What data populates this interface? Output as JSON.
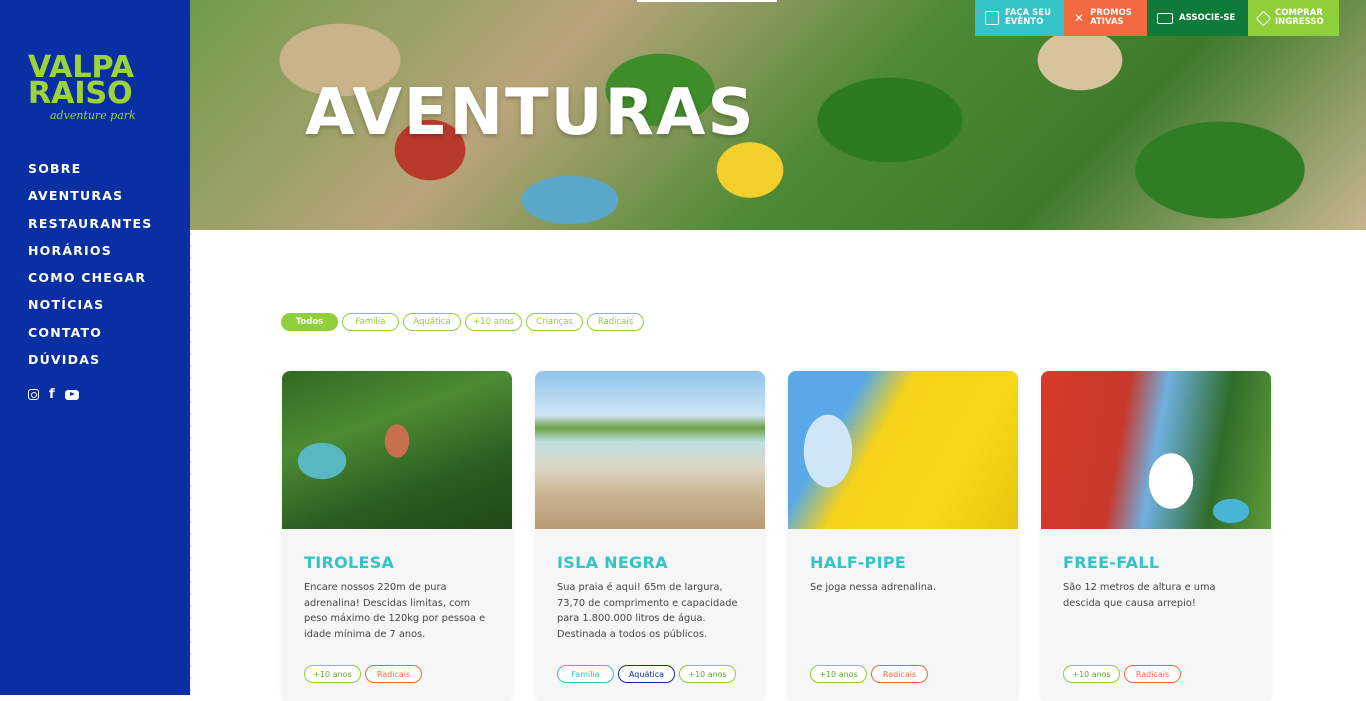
{
  "brand": {
    "logo_line1": "VALPA",
    "logo_line2": "RAISO",
    "logo_sub": "adventure park",
    "primary_color": "#0a2fa3",
    "accent_green": "#8fcf3a",
    "accent_teal": "#34c3c6"
  },
  "nav": {
    "items": [
      "SOBRE",
      "AVENTURAS",
      "RESTAURANTES",
      "HORÁRIOS",
      "COMO CHEGAR",
      "NOTÍCIAS",
      "CONTATO",
      "DÚVIDAS"
    ]
  },
  "social": [
    "instagram-icon",
    "facebook-icon",
    "youtube-icon"
  ],
  "hero": {
    "title": "AVENTURAS"
  },
  "top_actions": [
    {
      "line1": "FAÇA SEU",
      "line2": "EVENTO",
      "icon": "party-icon",
      "color": "#34c3c6"
    },
    {
      "line1": "PROMOS",
      "line2": "ATIVAS",
      "icon": "percent-icon",
      "color": "#f2683f"
    },
    {
      "line1": "ASSOCIE-SE",
      "line2": "",
      "icon": "id-card-icon",
      "color": "#0f7a3a"
    },
    {
      "line1": "COMPRAR",
      "line2": "INGRESSO",
      "icon": "ticket-icon",
      "color": "#8fcf3a"
    }
  ],
  "filters": [
    "Todos",
    "Família",
    "Aquática",
    "+10 anos",
    "Crianças",
    "Radicais"
  ],
  "active_filter": "Todos",
  "cards": [
    {
      "title": "TIROLESA",
      "description": "Encare nossos 220m de pura adrenalina! Descidas limitas, com peso máximo de 120kg por pessoa e idade mínima de 7 anos.",
      "tags": [
        "+10 anos",
        "Radicais"
      ]
    },
    {
      "title": "ISLA NEGRA",
      "description": "Sua praia é aqui! 65m de largura, 73,70 de comprimento e capacidade para 1.800.000 litros de água. Destinada a todos os públicos.",
      "tags": [
        "Família",
        "Aquática",
        "+10 anos"
      ]
    },
    {
      "title": "HALF-PIPE",
      "description": "Se joga nessa adrenalina.",
      "tags": [
        "+10 anos",
        "Radicais"
      ]
    },
    {
      "title": "FREE-FALL",
      "description": "São 12 metros de altura e uma descida que causa arrepio!",
      "tags": [
        "+10 anos",
        "Radicais"
      ]
    }
  ]
}
